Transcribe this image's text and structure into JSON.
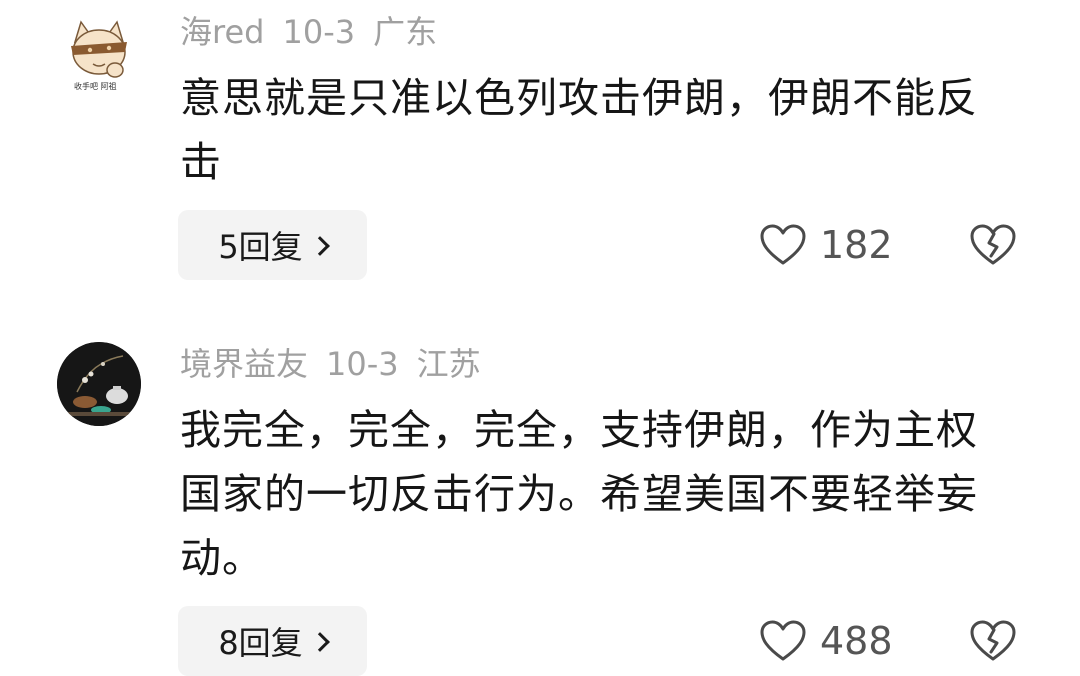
{
  "comments": [
    {
      "username": "海red",
      "date": "10-3",
      "location": "广东",
      "text": "意思就是只准以色列攻击伊朗，伊朗不能反击",
      "replies_label": "5回复",
      "likes": "182",
      "avatar_caption": "收手吧 阿祖",
      "icons": [
        "cat-avatar",
        "heart-icon",
        "broken-heart-icon",
        "chevron-right-icon"
      ]
    },
    {
      "username": "境界益友",
      "date": "10-3",
      "location": "江苏",
      "text": "我完全，完全，完全，支持伊朗，作为主权国家的一切反击行为。希望美国不要轻举妄动。",
      "replies_label": "8回复",
      "likes": "488",
      "icons": [
        "still-life-avatar",
        "heart-icon",
        "broken-heart-icon",
        "chevron-right-icon"
      ]
    }
  ],
  "colors": {
    "meta_text": "#a0a0a0",
    "body_text": "#161616",
    "reply_bg": "#f3f3f3",
    "icon_stroke": "#4a4a4a"
  }
}
